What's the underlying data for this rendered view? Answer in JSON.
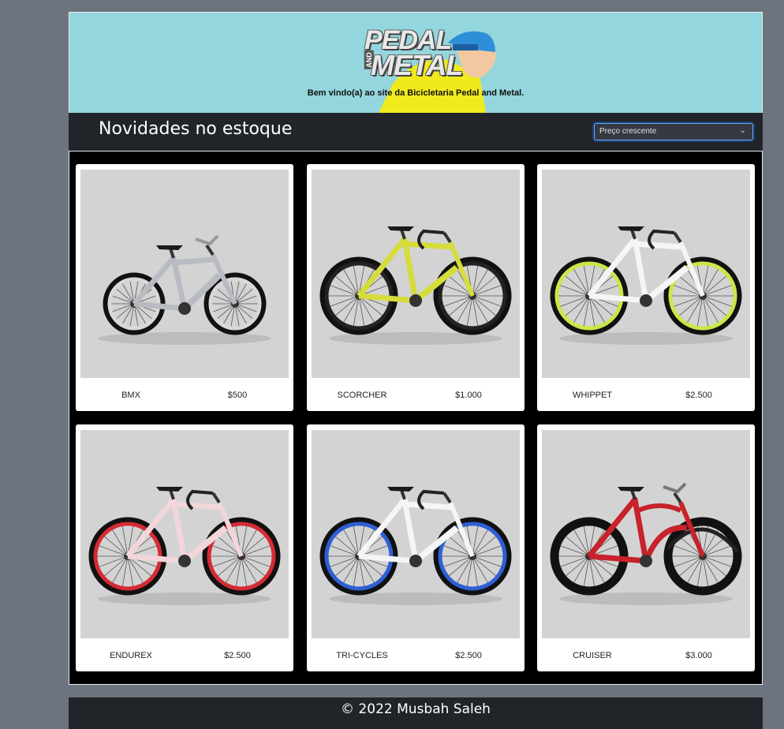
{
  "header": {
    "logo_top": "PEDAL",
    "logo_and": "AND",
    "logo_bottom": "METAL",
    "welcome": "Bem vindo(a) ao site da Bicicletaria Pedal and Metal."
  },
  "toolbar": {
    "title": "Novidades no estoque",
    "sort_selected": "Preço crescente"
  },
  "products": [
    {
      "name": "BMX",
      "price": "$500",
      "icon": "bmx-bike-image",
      "frame_color": "#b8bcc2",
      "rim_color": "#d8d8d8"
    },
    {
      "name": "SCORCHER",
      "price": "$1.000",
      "icon": "mountain-bike-image",
      "frame_color": "#d6dc3a",
      "rim_color": "#222222"
    },
    {
      "name": "WHIPPET",
      "price": "$2.500",
      "icon": "road-bike-image",
      "frame_color": "#f5f5f5",
      "rim_color": "#c8e84a"
    },
    {
      "name": "ENDUREX",
      "price": "$2.500",
      "icon": "road-bike-image",
      "frame_color": "#f2d6da",
      "rim_color": "#d62b34"
    },
    {
      "name": "TRI-CYCLES",
      "price": "$2.500",
      "icon": "road-bike-image",
      "frame_color": "#f5f5f5",
      "rim_color": "#2f5fd6"
    },
    {
      "name": "CRUISER",
      "price": "$3.000",
      "icon": "cruiser-bike-image",
      "frame_color": "#c8222a",
      "rim_color": "#111111"
    }
  ],
  "footer": {
    "text": "© 2022 Musbah Saleh"
  },
  "colors": {
    "background": "#6c757d",
    "banner": "#94d6dd",
    "toolbar": "#212529",
    "grid": "#000000",
    "image_bg": "#d3d3d3"
  }
}
